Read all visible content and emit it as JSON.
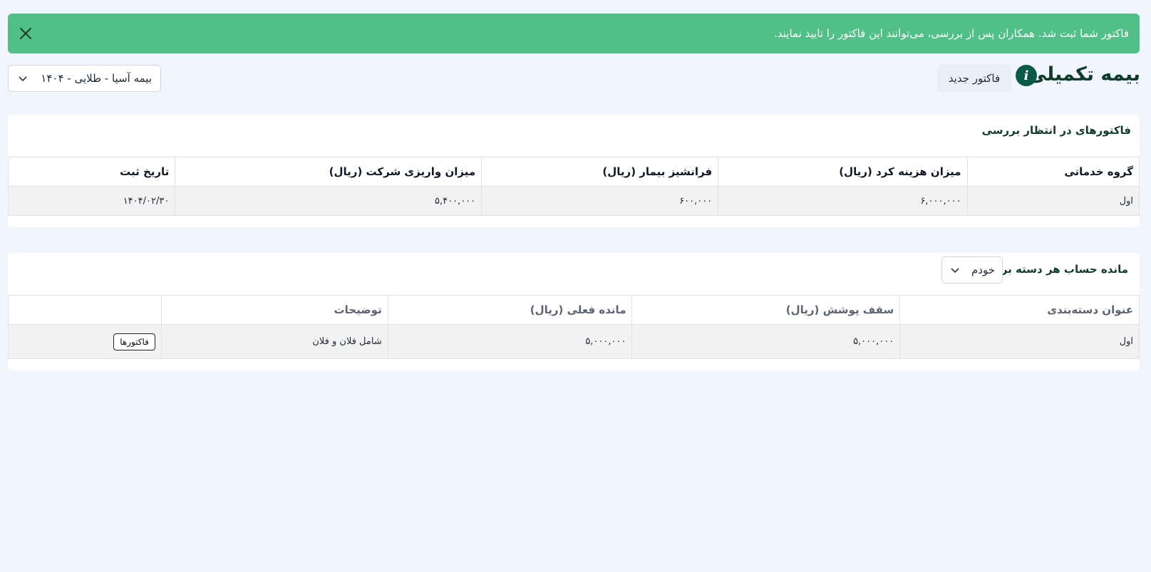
{
  "alert": {
    "message": "فاکتور شما ثبت شد. همکاران پس از بررسی، می‌توانند این فاکتور را تایید نمایند.",
    "close_icon": "close-icon"
  },
  "header": {
    "title": "بیمه تکمیلی",
    "info_icon": "i",
    "new_invoice_label": "فاکتور جدید",
    "plan_select_value": "بیمه آسیا - طلایی - ۱۴۰۴"
  },
  "pending": {
    "title": "فاکتورهای در انتظار بررسی",
    "columns": [
      "گروه خدماتی",
      "میزان هزینه کرد (ریال)",
      "فرانشیز بیمار (ریال)",
      "میزان واریزی شرکت (ریال)",
      "تاریخ ثبت"
    ],
    "rows": [
      [
        "اول",
        "۶,۰۰۰,۰۰۰",
        "۶۰۰,۰۰۰",
        "۵,۴۰۰,۰۰۰",
        "۱۴۰۴/۰۲/۳۰"
      ]
    ]
  },
  "balance": {
    "title": "مانده حساب هر دسته برای",
    "select_value": "خودم",
    "columns": [
      "عنوان دسته‌بندی",
      "سقف پوشش (ریال)",
      "مانده فعلی (ریال)",
      "توضیحات",
      ""
    ],
    "rows": [
      {
        "category": "اول",
        "cap": "۵,۰۰۰,۰۰۰",
        "remaining": "۵,۰۰۰,۰۰۰",
        "desc": "شامل فلان و فلان",
        "button": "فاکتورها"
      }
    ]
  },
  "colors": {
    "alert_bg": "#51c088",
    "title_color": "#0e3b2c",
    "info_icon_bg": "#0b5a45",
    "page_bg": "#f0f5fe"
  }
}
